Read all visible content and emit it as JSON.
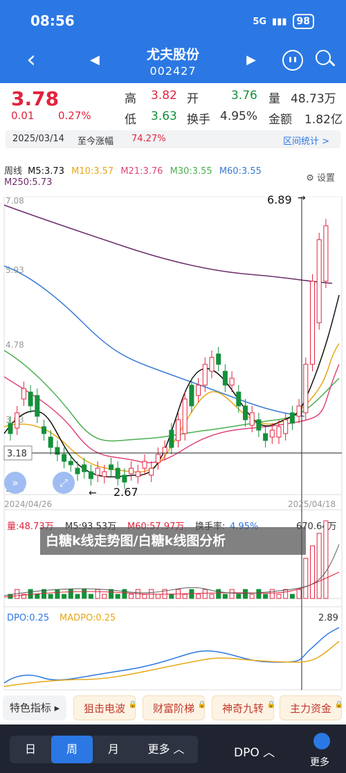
{
  "status": {
    "time": "08:56",
    "signal": "5G",
    "battery": "98"
  },
  "nav": {
    "back_icon": "‹",
    "prev_icon": "◀",
    "next_icon": "▶",
    "title": "尤夫股份",
    "code": "002427"
  },
  "quote": {
    "price": "3.78",
    "change": "0.01",
    "change_pct": "0.27%",
    "high_lbl": "高",
    "high": "3.82",
    "open_lbl": "开",
    "open": "3.76",
    "vol_lbl": "量",
    "vol": "48.73万",
    "low_lbl": "低",
    "low": "3.63",
    "turn_lbl": "换手",
    "turn": "4.95%",
    "amt_lbl": "金额",
    "amt": "1.82亿",
    "date": "2025/03/14",
    "rise_lbl": "至今涨幅",
    "rise": "74.27%",
    "range_stat": "区间统计 >"
  },
  "ma": {
    "period": "周线",
    "ma5": "M5:3.73",
    "ma10": "M10:3.57",
    "ma21": "M21:3.76",
    "ma30": "M30:3.55",
    "ma60": "M60:3.55",
    "ma250": "M250:5.73",
    "settings": "设置"
  },
  "kline": {
    "y_labels": [
      "7.08",
      "5.93",
      "4.78",
      "3.63",
      "2.48"
    ],
    "current_line": "3.18",
    "max_label": "6.89",
    "min_label": "2.67",
    "date_start": "2024/04/26",
    "date_end": "2025/04/18"
  },
  "volume": {
    "vol": "量:48.73万",
    "m5": "M5:93.53万",
    "m60": "M60:57.97万",
    "turn_lbl": "换手率:",
    "turn_val": "4.95%",
    "max": "670.64万"
  },
  "dpo": {
    "dpo": "DPO:0.25",
    "madpo": "MADPO:0.25",
    "max": "2.89"
  },
  "banner": "白糖k线走势图/白糖k线图分析",
  "tools": {
    "first": "特色指标 ▸",
    "t1": "狙击电波",
    "t2": "财富阶梯",
    "t3": "神奇九转",
    "t4": "主力资金"
  },
  "bottom": {
    "day": "日",
    "week": "周",
    "month": "月",
    "more": "更多 ︿",
    "dpo": "DPO ︿",
    "more2": "更多"
  },
  "colors": {
    "up": "#e2233d",
    "down": "#14903a",
    "accent": "#2b78e4",
    "ma5": "#111111",
    "ma10": "#e6a817",
    "ma21": "#e0457b",
    "ma30": "#4caf50",
    "ma60": "#3a7bd5",
    "ma250": "#6b2d6b"
  }
}
